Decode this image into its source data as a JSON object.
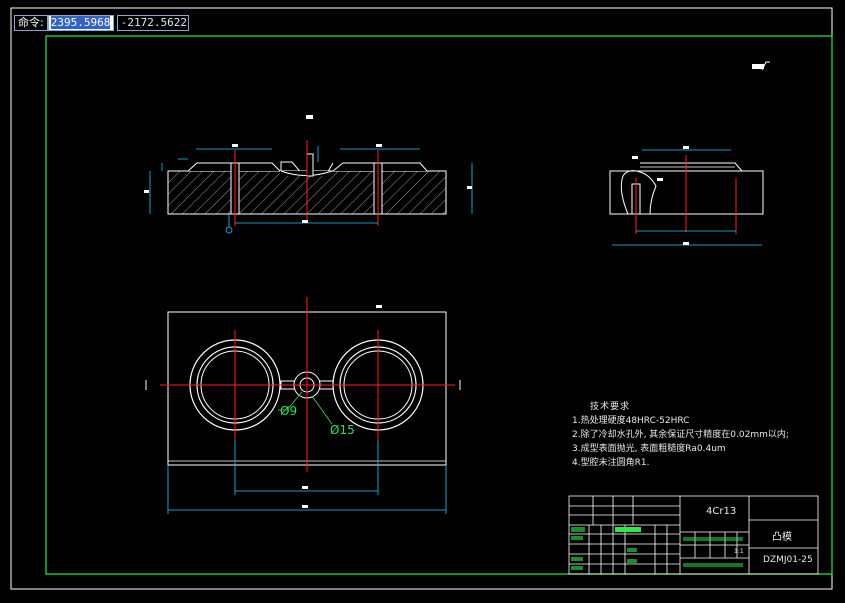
{
  "command_bar": {
    "label": "命令:",
    "x_value": "2395.5968",
    "y_value": "-2172.5622"
  },
  "technical_requirements": {
    "title": "技术要求",
    "items": [
      "1.热处理硬度48HRC-52HRC",
      "2.除了冷却水孔外, 其余保证尺寸精度在0.02mm以内;",
      "3.成型表面抛光, 表面粗糙度Ra0.4um",
      "4.型腔未注圆角R1."
    ]
  },
  "dimensions": {
    "small_hole": "Ø9",
    "large_hole": "Ø15"
  },
  "title_block": {
    "material": "4Cr13",
    "part_name": "凸模",
    "drawing_number": "DZMJ01-25",
    "scale": "1:1"
  },
  "colors": {
    "background": "#000000",
    "frame": "#00ff00",
    "outline": "#ffffff",
    "centerline": "#ff2020",
    "dimension": "#20c8ff",
    "hatch": "#ffffff"
  }
}
